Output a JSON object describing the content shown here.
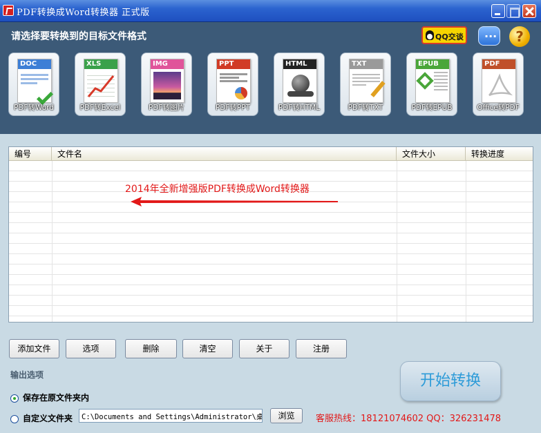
{
  "window": {
    "title": "PDF转换成Word转换器 正式版"
  },
  "header": {
    "instruction": "请选择要转换到的目标文件格式",
    "qq_label": "QQ交谈"
  },
  "formats": [
    {
      "tag": "DOC",
      "label": "PDF转Word",
      "color": "#3d7fd6"
    },
    {
      "tag": "XLS",
      "label": "PDF转Excel",
      "color": "#3aa14a"
    },
    {
      "tag": "IMG",
      "label": "PDF转图片",
      "color": "#e0549a"
    },
    {
      "tag": "PPT",
      "label": "PDF转PPT",
      "color": "#d13b26"
    },
    {
      "tag": "HTML",
      "label": "PDF转HTML",
      "color": "#222222"
    },
    {
      "tag": "TXT",
      "label": "PDF转TXT",
      "color": "#9a9a9a"
    },
    {
      "tag": "EPUB",
      "label": "PDF转EPUB",
      "color": "#4aa63a"
    },
    {
      "tag": "PDF",
      "label": "Office转PDF",
      "color": "#c0502a"
    }
  ],
  "table": {
    "columns": [
      "编号",
      "文件名",
      "文件大小",
      "转换进度"
    ],
    "banner": "2014年全新增强版PDF转换成Word转换器"
  },
  "buttons": {
    "add": "添加文件",
    "options": "选项",
    "delete": "删除",
    "clear": "清空",
    "about": "关于",
    "register": "注册"
  },
  "output": {
    "section_label": "输出选项",
    "option_original": "保存在原文件夹内",
    "option_custom": "自定义文件夹",
    "path": "C:\\Documents and Settings\\Administrator\\桌面",
    "browse": "浏览",
    "selected": "original"
  },
  "footer": {
    "hotline": "客服热线：18121074602 QQ：326231478",
    "start": "开始转换"
  }
}
